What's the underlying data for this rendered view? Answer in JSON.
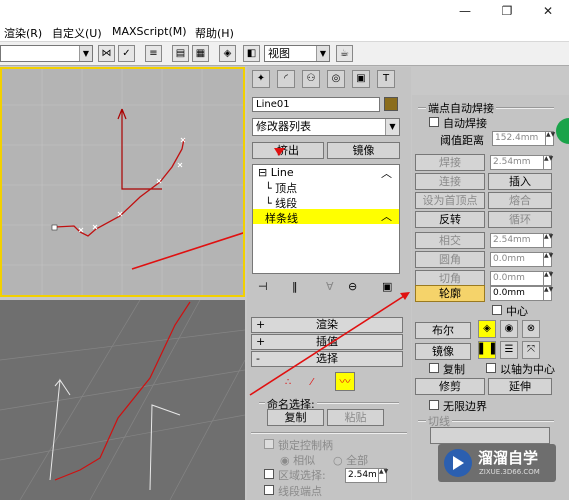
{
  "window": {
    "minimize": "—",
    "maximize": "❐",
    "close": "✕"
  },
  "menu": [
    "渲染(R)",
    "自定义(U)",
    "MAXScript(M)",
    "帮助(H)"
  ],
  "toolbar": {
    "view_dropdown": "视图"
  },
  "cmd": {
    "object_name": "Line01",
    "modifier_list": "修改器列表",
    "extrude_label": "挤出",
    "mirror_label": "镜像",
    "stack": {
      "root": "Line",
      "vertex": "顶点",
      "segment": "线段",
      "spline": "样条线"
    },
    "rollouts": {
      "render": "渲染",
      "interp": "插值",
      "select": "选择"
    },
    "named_sel_title": "命名选择:",
    "copy_label": "复制",
    "paste_label": "粘贴",
    "lock_handles": "锁定控制柄",
    "similar": "相似",
    "all": "全部",
    "area_select": "区域选择:",
    "area_value": "2.54m",
    "segment_end": "线段端点"
  },
  "geom": {
    "weld_title": "端点自动焊接",
    "auto_weld": "自动焊接",
    "threshold_label": "阈值距离",
    "threshold_value": "152.4mm",
    "weld": "焊接",
    "weld_value": "2.54mm",
    "connect": "连接",
    "insert": "插入",
    "make_first": "设为首顶点",
    "fuse": "熔合",
    "reverse": "反转",
    "cycle": "循环",
    "intersect": "相交",
    "intersect_value": "2.54mm",
    "fillet": "圆角",
    "fillet_value": "0.0mm",
    "chamfer": "切角",
    "chamfer_value": "0.0mm",
    "outline": "轮廓",
    "outline_value": "0.0mm",
    "center": "中心",
    "boolean": "布尔",
    "mirror": "镜像",
    "copy": "复制",
    "about_pivot": "以轴为中心",
    "trim": "修剪",
    "extend": "延伸",
    "infinite": "无限边界",
    "tangent_title": "切线"
  },
  "watermark": {
    "brand": "溜溜自学",
    "url": "ZIXUE.3D66.COM"
  },
  "colors": {
    "viewport_border": "#f2d000",
    "highlight": "#ffff00",
    "outline_btn": "#f5d36a",
    "arrow": "#e01010"
  }
}
